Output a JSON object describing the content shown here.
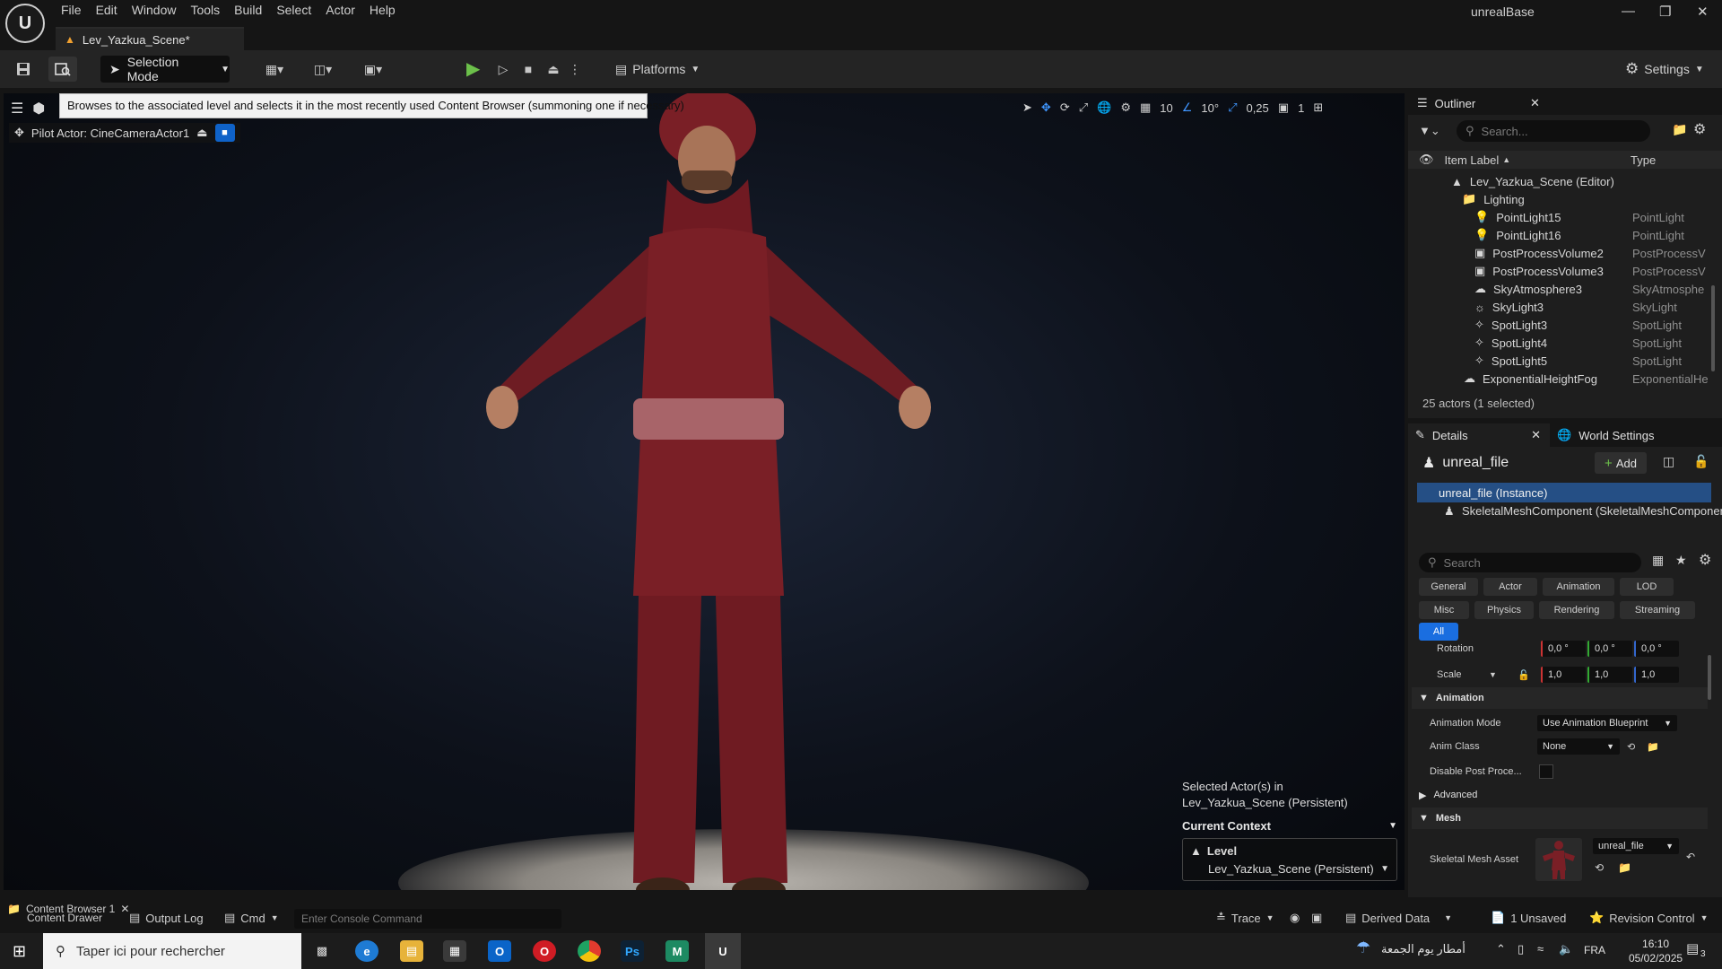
{
  "menubar": {
    "items": [
      "File",
      "Edit",
      "Window",
      "Tools",
      "Build",
      "Select",
      "Actor",
      "Help"
    ],
    "app_title": "unrealBase",
    "logo_text": "U"
  },
  "tab": {
    "title": "Lev_Yazkua_Scene*"
  },
  "toolbar": {
    "selection_mode": "Selection Mode",
    "platforms": "Platforms",
    "settings": "Settings"
  },
  "viewport": {
    "tooltip": "Browses to the associated level and selects it in the most recently used Content Browser (summoning one if necessary)",
    "pilot_actor": "Pilot Actor: CineCameraActor1",
    "grid_snap": "10",
    "rotation_snap": "10°",
    "scale_snap": "0,25",
    "camera_speed": "1",
    "selected_actors_line1": "Selected Actor(s) in",
    "selected_actors_line2": "Lev_Yazkua_Scene (Persistent)",
    "current_context": "Current Context",
    "level_label": "Level",
    "level_value": "Lev_Yazkua_Scene (Persistent)"
  },
  "outliner": {
    "title": "Outliner",
    "search_placeholder": "Search...",
    "col_label": "Item Label",
    "col_type": "Type",
    "root": "Lev_Yazkua_Scene (Editor)",
    "folder": "Lighting",
    "rows": [
      {
        "name": "PointLight15",
        "type": "PointLight",
        "icon": "bulb-icon"
      },
      {
        "name": "PointLight16",
        "type": "PointLight",
        "icon": "bulb-icon"
      },
      {
        "name": "PostProcessVolume2",
        "type": "PostProcessV",
        "icon": "volume-icon"
      },
      {
        "name": "PostProcessVolume3",
        "type": "PostProcessV",
        "icon": "volume-icon"
      },
      {
        "name": "SkyAtmosphere3",
        "type": "SkyAtmosphe",
        "icon": "sky-icon"
      },
      {
        "name": "SkyLight3",
        "type": "SkyLight",
        "icon": "skylight-icon"
      },
      {
        "name": "SpotLight3",
        "type": "SpotLight",
        "icon": "spotlight-icon"
      },
      {
        "name": "SpotLight4",
        "type": "SpotLight",
        "icon": "spotlight-icon"
      },
      {
        "name": "SpotLight5",
        "type": "SpotLight",
        "icon": "spotlight-icon"
      }
    ],
    "fog_row": {
      "name": "ExponentialHeightFog",
      "type": "ExponentialHe"
    },
    "actor_count": "25 actors (1 selected)"
  },
  "details": {
    "tab_details": "Details",
    "tab_world": "World Settings",
    "object_name": "unreal_file",
    "add_label": "Add",
    "instance": "unreal_file (Instance)",
    "component": "SkeletalMeshComponent (SkeletalMeshComponent)",
    "search_placeholder": "Search",
    "filters_row1": [
      "General",
      "Actor",
      "Animation",
      "LOD"
    ],
    "filters_row2": [
      "Misc",
      "Physics",
      "Rendering",
      "Streaming"
    ],
    "filter_all": "All",
    "rotation_label": "Rotation",
    "rotation_values": [
      "0,0 °",
      "0,0 °",
      "0,0 °"
    ],
    "scale_label": "Scale",
    "scale_values": [
      "1,0",
      "1,0",
      "1,0"
    ],
    "sect_animation": "Animation",
    "anim_mode_label": "Animation Mode",
    "anim_mode_value": "Use Animation Blueprint",
    "anim_class_label": "Anim Class",
    "anim_class_value": "None",
    "disable_pp_label": "Disable Post Proce...",
    "sect_advanced": "Advanced",
    "sect_mesh": "Mesh",
    "skel_mesh_label": "Skeletal Mesh Asset",
    "skel_mesh_value": "unreal_file"
  },
  "statusbar": {
    "content_drawer": "Content Drawer",
    "content_browser": "Content Browser 1",
    "output_log": "Output Log",
    "cmd": "Cmd",
    "console_placeholder": "Enter Console Command",
    "trace": "Trace",
    "derived_data": "Derived Data",
    "unsaved": "1 Unsaved",
    "revision_control": "Revision Control"
  },
  "taskbar": {
    "search_placeholder": "Taper ici pour rechercher",
    "weather": "أمطار يوم الجمعة",
    "lang": "FRA",
    "time": "16:10",
    "date": "05/02/2025",
    "notif_count": "3"
  },
  "colors": {
    "accent": "#1a6ee0",
    "play": "#6cc04a",
    "selection": "#254f85",
    "robe": "#7a1f26"
  }
}
